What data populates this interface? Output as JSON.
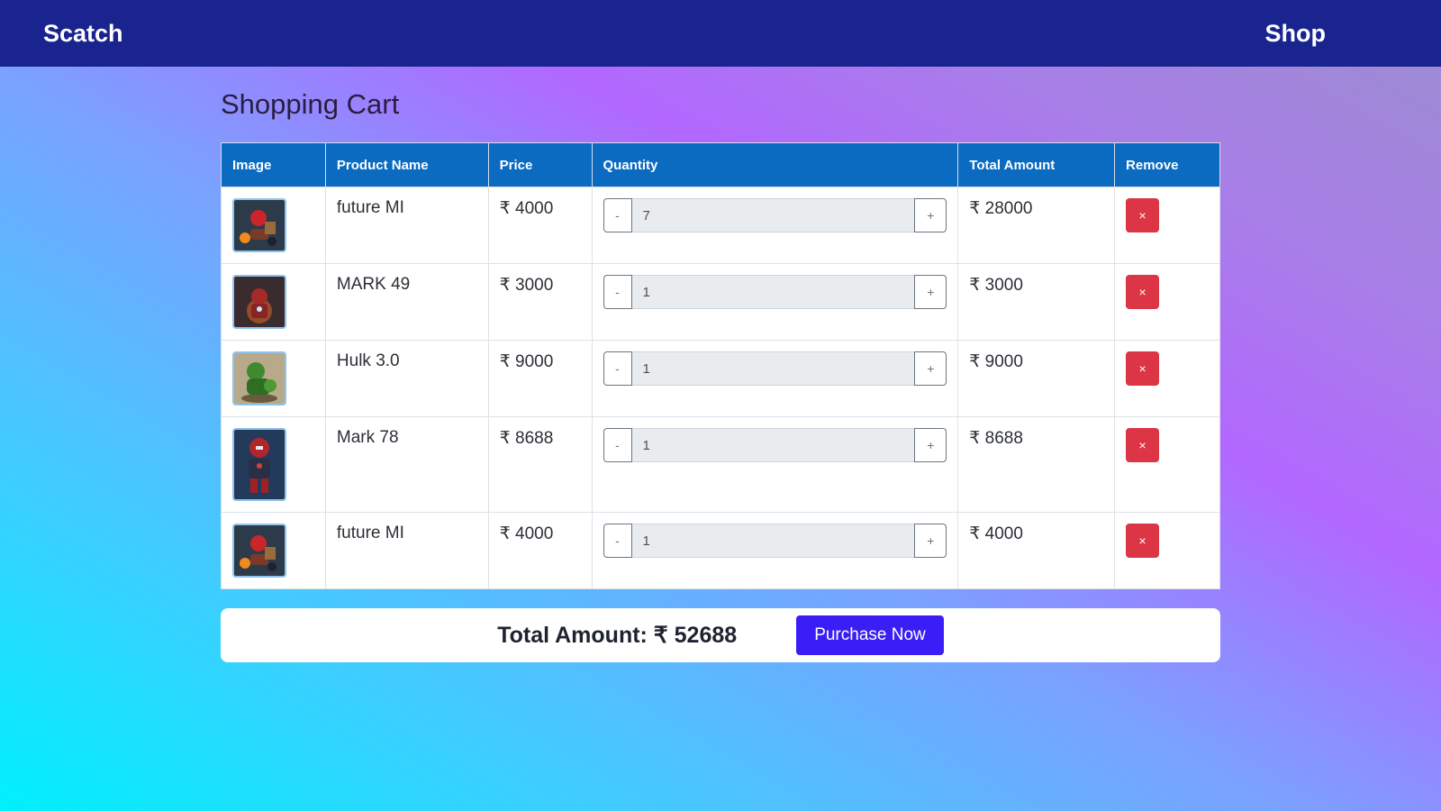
{
  "navbar": {
    "brand": "Scatch",
    "shop_link": "Shop"
  },
  "page": {
    "title": "Shopping Cart"
  },
  "table": {
    "headers": {
      "image": "Image",
      "name": "Product Name",
      "price": "Price",
      "quantity": "Quantity",
      "total": "Total Amount",
      "remove": "Remove"
    },
    "rows": [
      {
        "name": "future MI",
        "price": "₹ 4000",
        "quantity": "7",
        "total": "₹ 28000",
        "thumb": "rider-thumb"
      },
      {
        "name": "MARK 49",
        "price": "₹ 3000",
        "quantity": "1",
        "total": "₹ 3000",
        "thumb": "armor-red-thumb"
      },
      {
        "name": "Hulk 3.0",
        "price": "₹ 9000",
        "quantity": "1",
        "total": "₹ 9000",
        "thumb": "hulk-thumb"
      },
      {
        "name": "Mark 78",
        "price": "₹ 8688",
        "quantity": "1",
        "total": "₹ 8688",
        "thumb": "armor-tall-thumb"
      },
      {
        "name": "future MI",
        "price": "₹ 4000",
        "quantity": "1",
        "total": "₹ 4000",
        "thumb": "rider-thumb"
      }
    ],
    "minus_label": "-",
    "plus_label": "+",
    "remove_label": "×"
  },
  "summary": {
    "total_text": "Total Amount: ₹ 52688",
    "purchase_label": "Purchase Now"
  },
  "colors": {
    "navbar": "#19248f",
    "table_header": "#0a6bc1",
    "remove": "#dc3545",
    "purchase": "#3a1ef5"
  }
}
